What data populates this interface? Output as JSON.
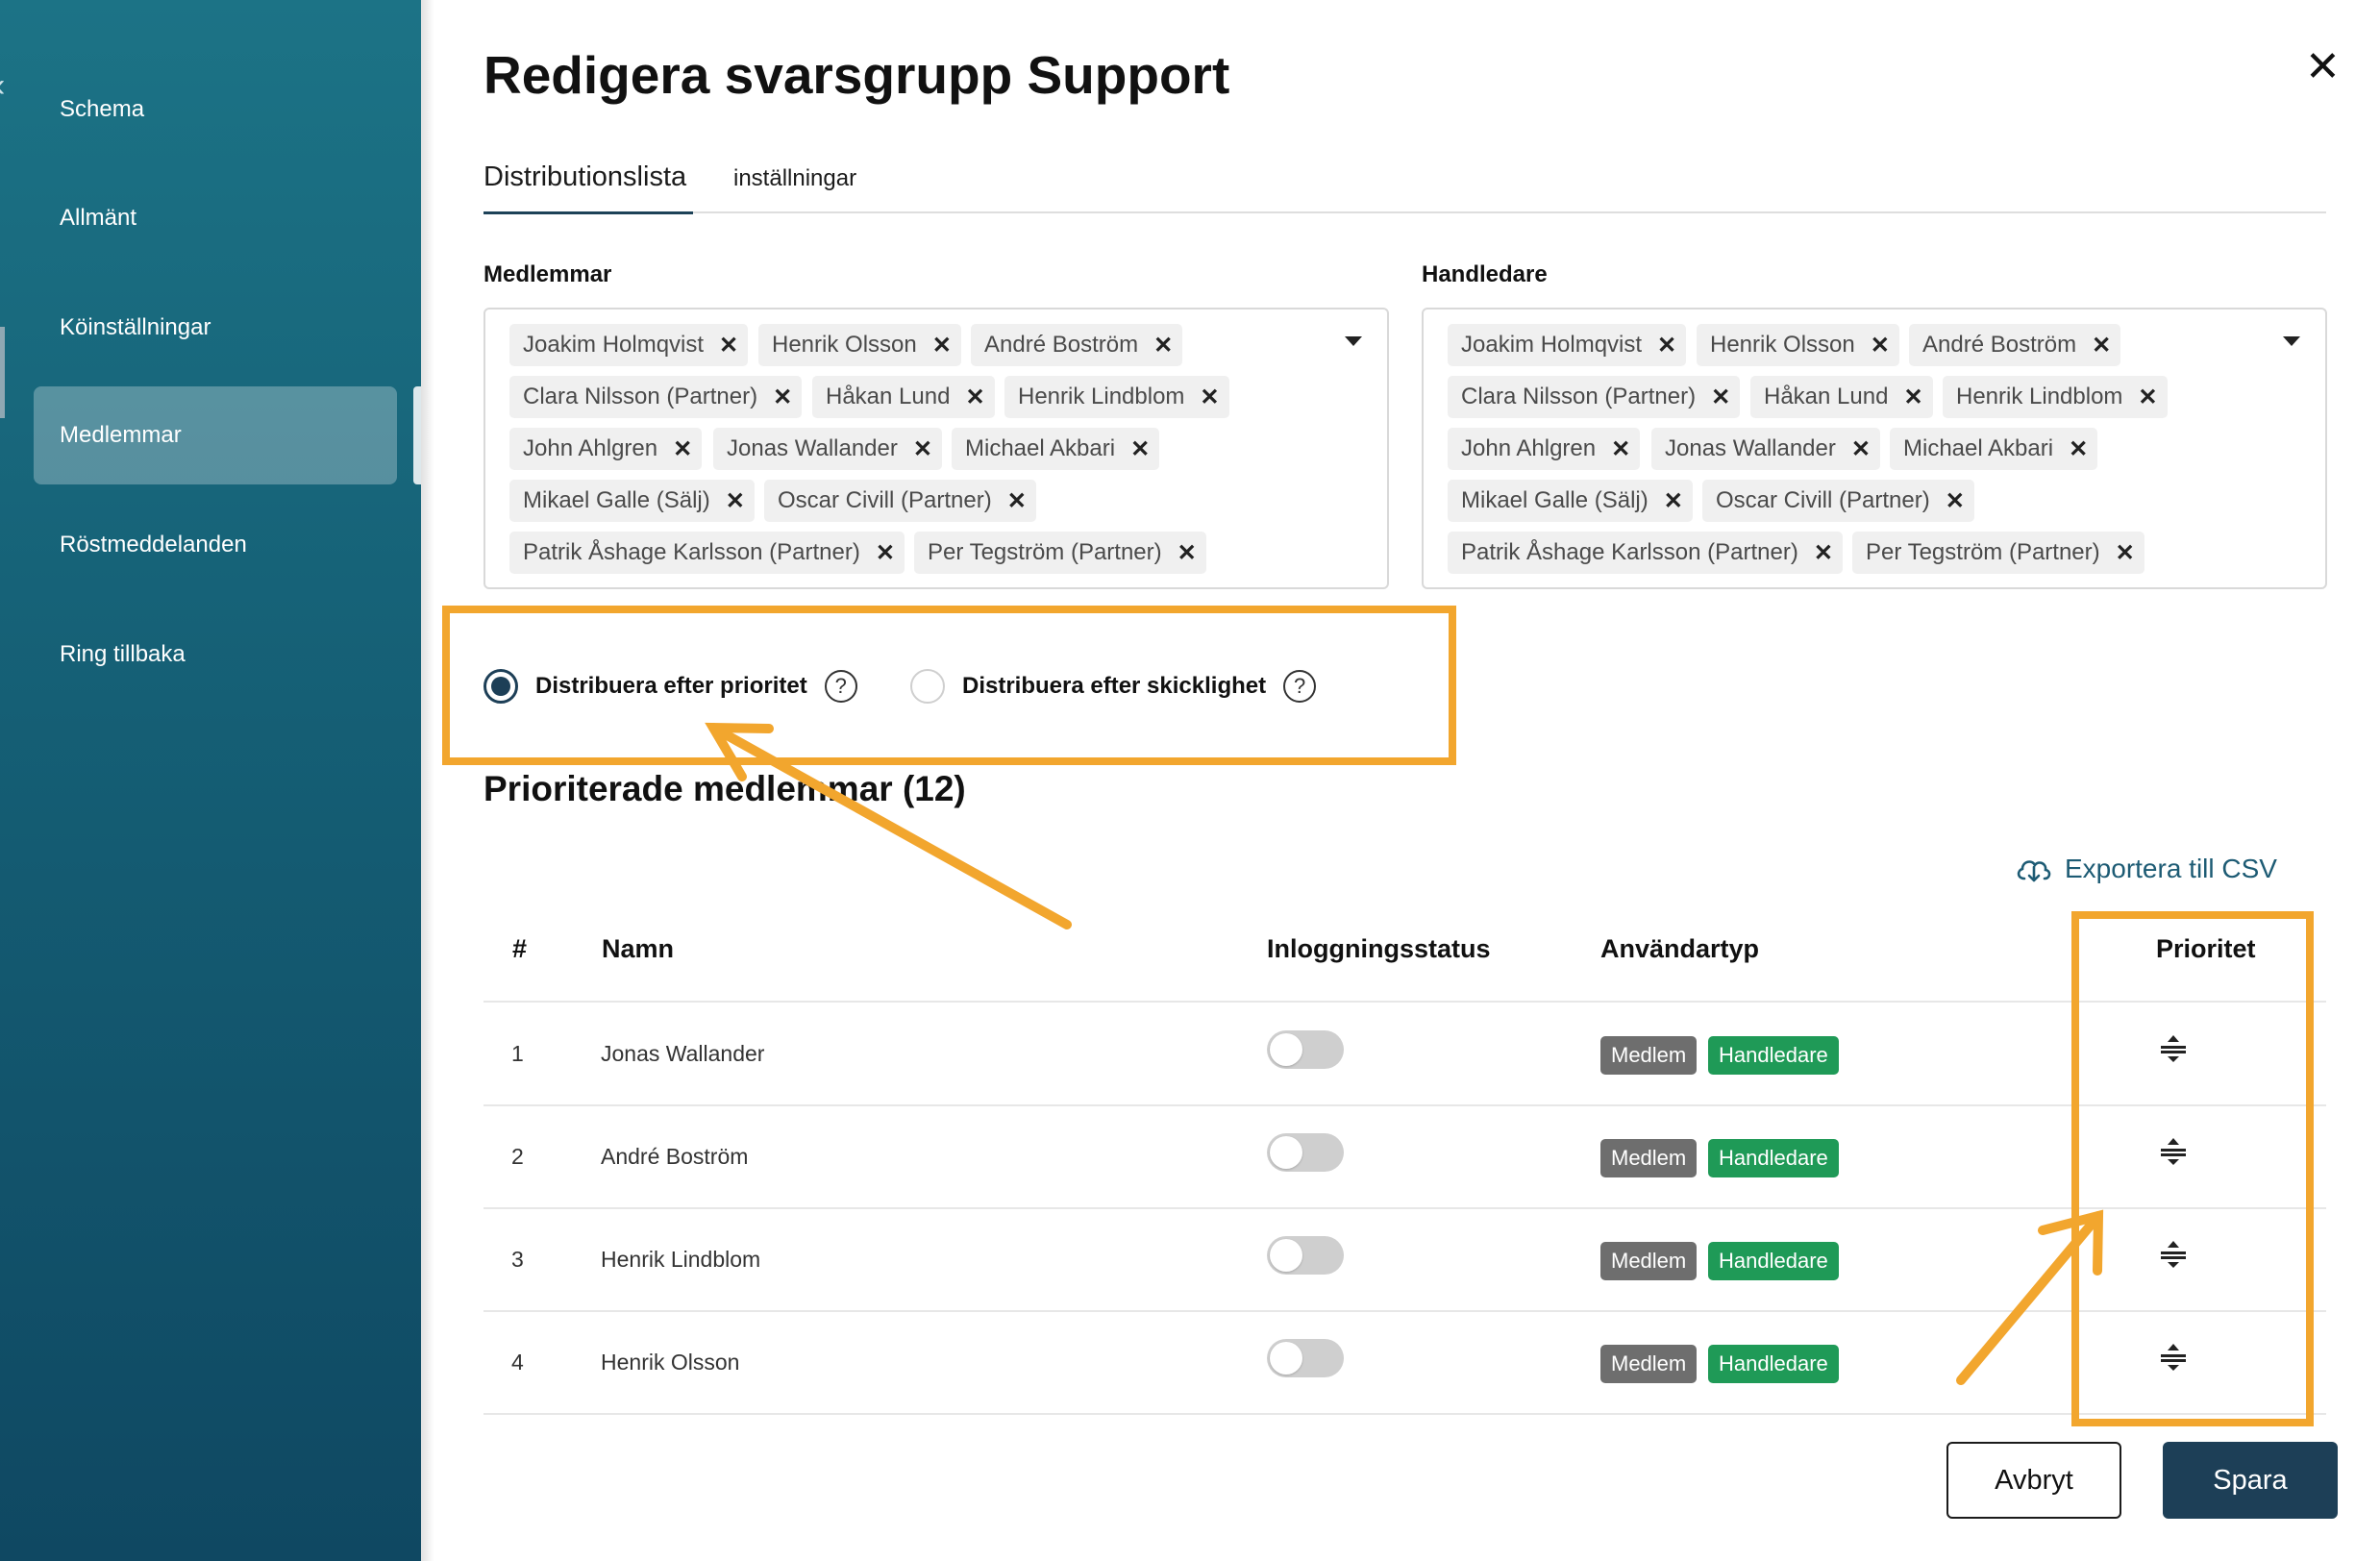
{
  "sidebar": {
    "items": [
      {
        "label": "Schema"
      },
      {
        "label": "Allmänt"
      },
      {
        "label": "Köinställningar"
      },
      {
        "label": "Medlemmar",
        "active": true
      },
      {
        "label": "Röstmeddelanden"
      },
      {
        "label": "Ring tillbaka"
      }
    ]
  },
  "dialog": {
    "title": "Redigera svarsgrupp Support",
    "close_icon": "close-icon"
  },
  "tabs": [
    {
      "label": "Distributionslista",
      "active": true
    },
    {
      "label": "inställningar"
    }
  ],
  "members": {
    "label": "Medlemmar",
    "chips": [
      "Joakim Holmqvist",
      "Henrik Olsson",
      "André Boström",
      "Clara Nilsson (Partner)",
      "Håkan Lund",
      "Henrik Lindblom",
      "John Ahlgren",
      "Jonas Wallander",
      "Michael Akbari",
      "Mikael Galle (Sälj)",
      "Oscar Civill (Partner)",
      "Patrik Åshage Karlsson (Partner)",
      "Per Tegström (Partner)"
    ]
  },
  "supervisors": {
    "label": "Handledare",
    "chips": [
      "Joakim Holmqvist",
      "Henrik Olsson",
      "André Boström",
      "Clara Nilsson (Partner)",
      "Håkan Lund",
      "Henrik Lindblom",
      "John Ahlgren",
      "Jonas Wallander",
      "Michael Akbari",
      "Mikael Galle (Sälj)",
      "Oscar Civill (Partner)",
      "Patrik Åshage Karlsson (Partner)",
      "Per Tegström (Partner)"
    ]
  },
  "distribution": {
    "options": [
      {
        "label": "Distribuera efter prioritet",
        "selected": true
      },
      {
        "label": "Distribuera efter skicklighet",
        "selected": false
      }
    ],
    "help_symbol": "?"
  },
  "prioritized": {
    "heading": "Prioriterade medlemmar (12)",
    "export_label": "Exportera till CSV",
    "columns": [
      "#",
      "Namn",
      "Inloggningsstatus",
      "Användartyp",
      "Prioritet"
    ],
    "rows": [
      {
        "num": "1",
        "name": "Jonas Wallander",
        "logged_in": false,
        "types": [
          "Medlem",
          "Handledare"
        ]
      },
      {
        "num": "2",
        "name": "André Boström",
        "logged_in": false,
        "types": [
          "Medlem",
          "Handledare"
        ]
      },
      {
        "num": "3",
        "name": "Henrik Lindblom",
        "logged_in": false,
        "types": [
          "Medlem",
          "Handledare"
        ]
      },
      {
        "num": "4",
        "name": "Henrik Olsson",
        "logged_in": false,
        "types": [
          "Medlem",
          "Handledare"
        ]
      }
    ]
  },
  "footer": {
    "cancel": "Avbryt",
    "save": "Spara"
  },
  "colors": {
    "primary": "#1d3f57",
    "handler_badge": "#1f9a57",
    "member_badge": "#6e6e6e",
    "annotation": "#f2a62e"
  }
}
